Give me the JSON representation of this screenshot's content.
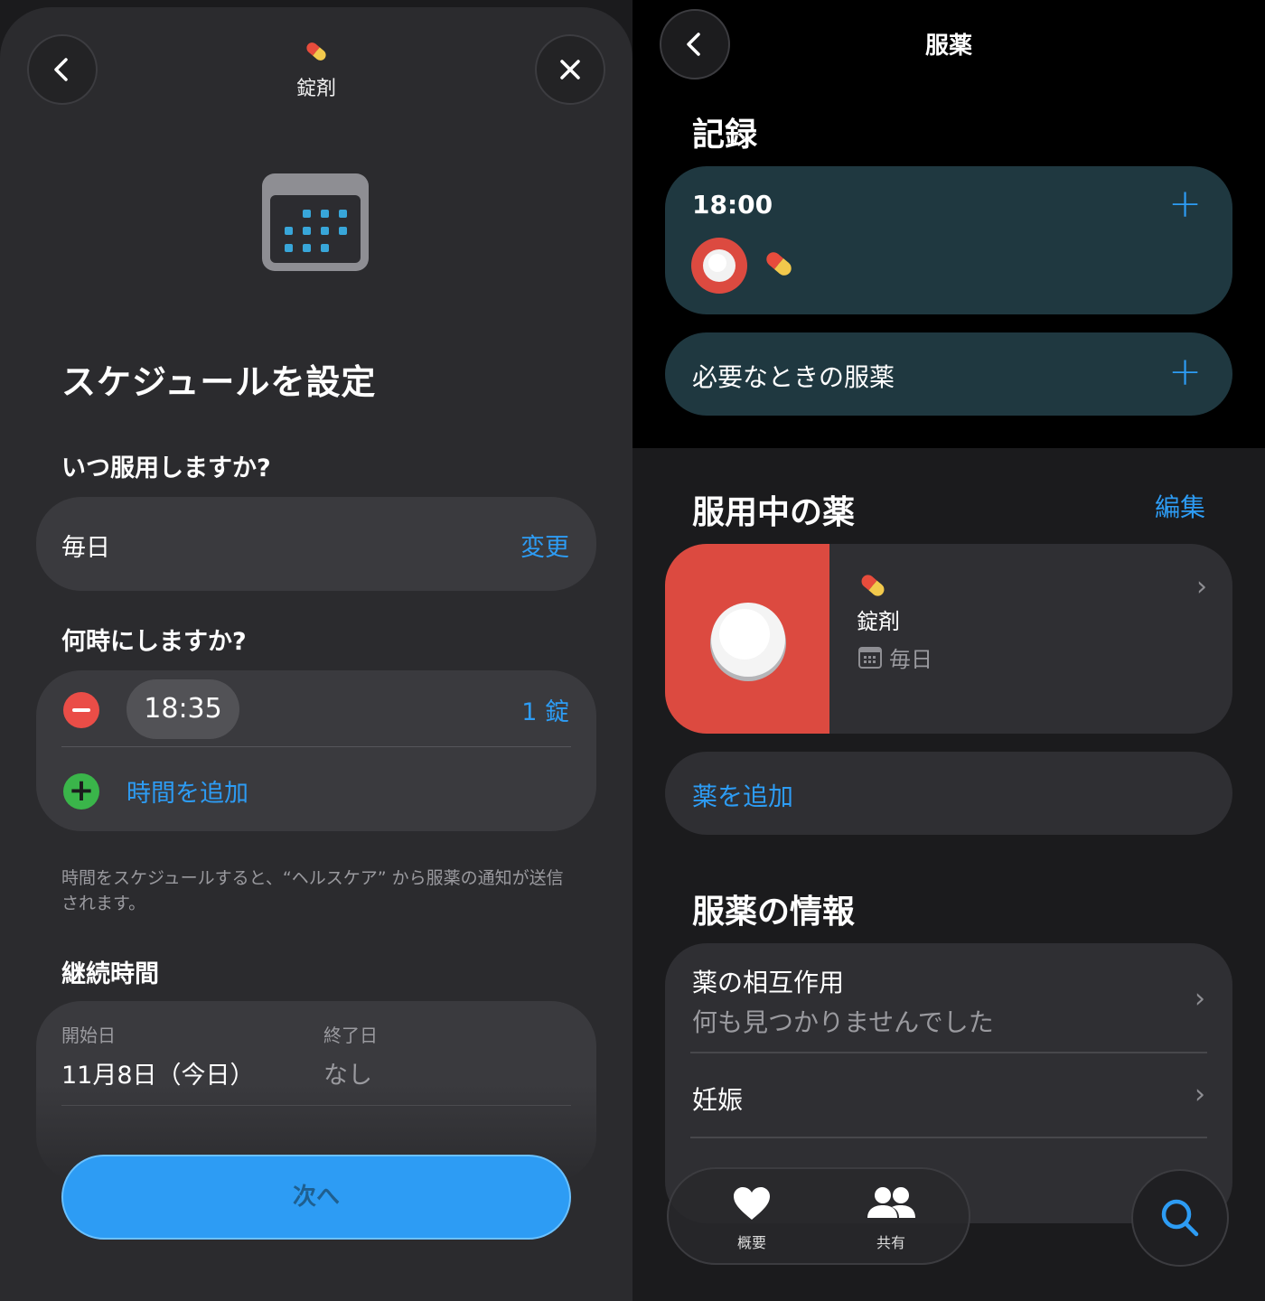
{
  "left": {
    "header": {
      "med_name": "錠剤"
    },
    "title": "スケジュールを設定",
    "frequency": {
      "label": "いつ服用しますか?",
      "value": "毎日",
      "action": "変更"
    },
    "times": {
      "label": "何時にしますか?",
      "entries": [
        {
          "time": "18:35",
          "dose": "1 錠"
        }
      ],
      "add_label": "時間を追加"
    },
    "note": "時間をスケジュールすると、“ヘルスケア” から服薬の通知が送信されます。",
    "duration": {
      "label": "継続時間",
      "start_label": "開始日",
      "start_value": "11月8日（今日）",
      "end_label": "終了日",
      "end_value": "なし"
    },
    "next_button": "次へ"
  },
  "right": {
    "title": "服薬",
    "log": {
      "label": "記録",
      "time": "18:00",
      "as_needed": "必要なときの服薬"
    },
    "current": {
      "label": "服用中の薬",
      "edit": "編集",
      "med_name": "錠剤",
      "schedule": "毎日",
      "add": "薬を追加"
    },
    "info": {
      "label": "服薬の情報",
      "interactions_title": "薬の相互作用",
      "interactions_value": "何も見つかりませんでした",
      "pregnancy": "妊娠"
    },
    "tabs": [
      {
        "label": "概要",
        "icon": "heart-icon"
      },
      {
        "label": "共有",
        "icon": "people-icon"
      }
    ],
    "colors": {
      "accent": "#2d9cf4",
      "teal_card": "#1f3840",
      "pill_red": "#dc4a40"
    }
  }
}
